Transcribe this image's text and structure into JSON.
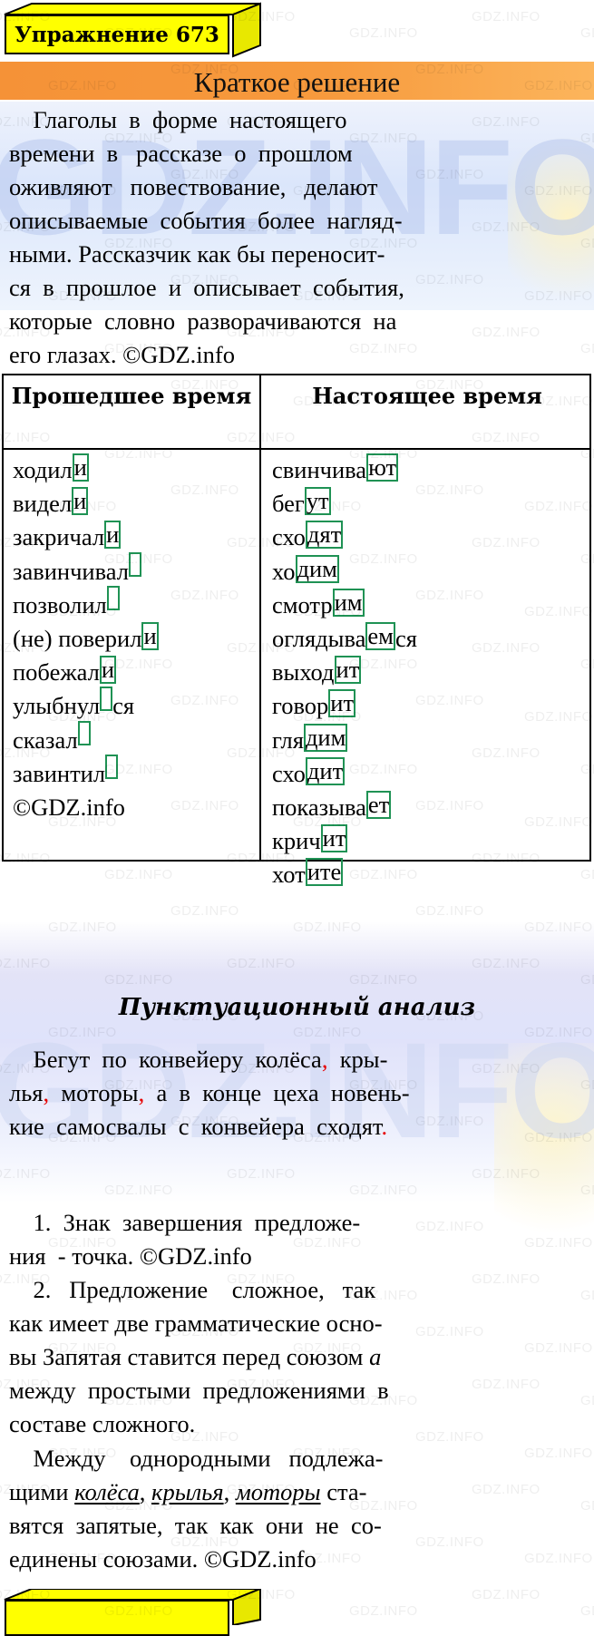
{
  "header": {
    "exercise_label": "Упражнение 673",
    "band_title": "Краткое решение"
  },
  "intro_paragraph": {
    "lines": [
      "    Глаголы  в  форме  настоящего",
      "времени  в   рассказе  о  прошлом",
      "оживляют   повествование,   делают",
      "описываемые  события  более  нагляд-",
      "ными. Рассказчик как бы переносит-",
      "ся  в  прошлое  и  описывает  события,",
      "которые  словно  разворачиваются  на",
      "его глазах. ©GDZ.info"
    ]
  },
  "table": {
    "headers": {
      "past": "Прошедшее время",
      "present": "Настоящее время"
    },
    "past_column": [
      {
        "stem": "ходил",
        "ending": "и"
      },
      {
        "stem": "видел",
        "ending": "и"
      },
      {
        "stem": "закричал",
        "ending": "и"
      },
      {
        "stem": "завинчивал",
        "ending": ""
      },
      {
        "stem": "позволил",
        "ending": ""
      },
      {
        "stem": "(не) поверил",
        "ending": "и"
      },
      {
        "stem": "побежал",
        "ending": "и"
      },
      {
        "stem": "улыбнул",
        "ending": "",
        "suffix": "ся"
      },
      {
        "stem": "сказал",
        "ending": ""
      },
      {
        "stem": "завинтил",
        "ending": ""
      },
      {
        "stem": "©GDZ.info",
        "ending": null
      }
    ],
    "present_column": [
      {
        "stem": "свинчива",
        "ending": "ют"
      },
      {
        "stem": "бег",
        "ending": "ут"
      },
      {
        "stem": "схо",
        "ending": "дят"
      },
      {
        "stem": "хо",
        "ending": "дим"
      },
      {
        "stem": "смотр",
        "ending": "им"
      },
      {
        "stem": "оглядыва",
        "ending": "ем",
        "suffix": "ся"
      },
      {
        "stem": "выход",
        "ending": "ит"
      },
      {
        "stem": "говор",
        "ending": "ит"
      },
      {
        "stem": "гля",
        "ending": "дим"
      },
      {
        "stem": "схо",
        "ending": "дит"
      },
      {
        "stem": "показыва",
        "ending": "ет"
      },
      {
        "stem": "крич",
        "ending": "ит"
      },
      {
        "stem": "хот",
        "ending": "ите"
      }
    ]
  },
  "punctuation_section": {
    "title": "Пунктуационный анализ",
    "sentence_lines": [
      {
        "parts": [
          {
            "t": "    Бегут  по  конвейеру  колёса",
            "c": "black"
          },
          {
            "t": ",",
            "c": "red"
          },
          {
            "t": "  кры-",
            "c": "black"
          }
        ]
      },
      {
        "parts": [
          {
            "t": "лья",
            "c": "black"
          },
          {
            "t": ",",
            "c": "red"
          },
          {
            "t": "  моторы",
            "c": "black"
          },
          {
            "t": ",",
            "c": "red"
          },
          {
            "t": "  а  в  конце  цеха  новень-",
            "c": "black"
          }
        ]
      },
      {
        "parts": [
          {
            "t": "кие  самосвалы  с  конвейера  сходят",
            "c": "black"
          },
          {
            "t": ".",
            "c": "red"
          }
        ]
      }
    ],
    "items": [
      {
        "lines": [
          "    1.  Знак  завершения  предложе-",
          "ния  - точка. ©GDZ.info"
        ]
      },
      {
        "lines": [
          "    2.   Предложение    сложное,   так",
          "как имеет две грамматические осно-",
          "вы Запятая ставится перед союзом ",
          "между  простыми  предложениями  в",
          "составе сложного."
        ],
        "italic_tail_line_index": 2,
        "italic_tail": "а"
      },
      {
        "lines": [
          "    Между    однородными   подлежа-",
          "щими ",
          "вятся  запятые,  так  как  они  не  со-",
          "единены союзами. ©GDZ.info"
        ],
        "underlined_words": [
          "колёса",
          "крылья",
          "моторы"
        ],
        "after_underlined": " ста-"
      }
    ]
  },
  "watermark": {
    "text": "GDZ.INFO",
    "logo_text": "GDZ.info"
  },
  "colors": {
    "band_start": "#f59237",
    "band_end": "#fcb55c",
    "yellow": "#ffff00",
    "green_box": "#1f9254",
    "red_punct": "#e60000"
  }
}
